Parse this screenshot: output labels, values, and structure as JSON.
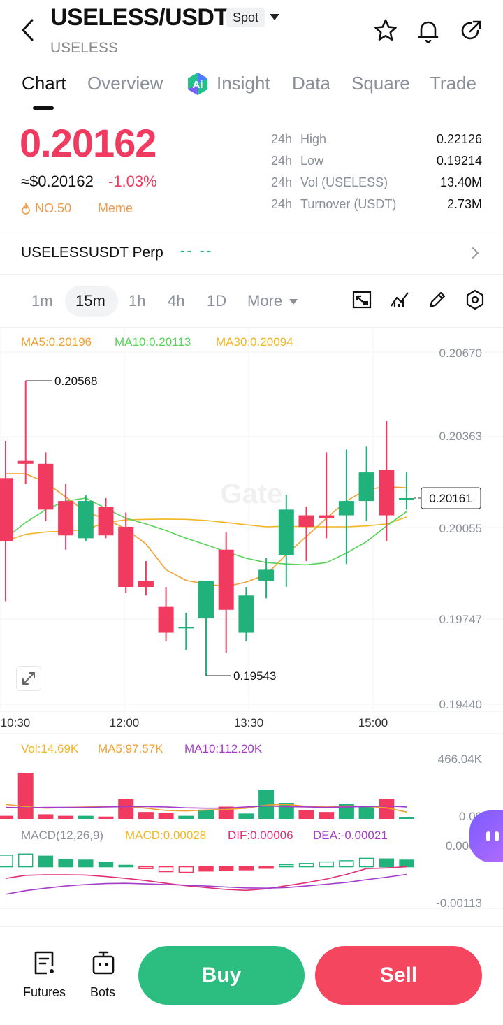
{
  "header": {
    "pair": "USELESS/USDT",
    "market_type": "Spot",
    "subtitle": "USELESS"
  },
  "tabs": [
    "Chart",
    "Overview",
    "Insight",
    "Data",
    "Square",
    "Trade"
  ],
  "price": {
    "last": "0.20162",
    "usd": "≈$0.20162",
    "change": "-1.03%",
    "rank": "NO.50",
    "tag": "Meme"
  },
  "stats": [
    {
      "period": "24h",
      "label": "High",
      "value": "0.22126"
    },
    {
      "period": "24h",
      "label": "Low",
      "value": "0.19214"
    },
    {
      "period": "24h",
      "label": "Vol (USELESS)",
      "value": "13.40M"
    },
    {
      "period": "24h",
      "label": "Turnover (USDT)",
      "value": "2.73M"
    }
  ],
  "perp": {
    "label": "USELESSUSDT Perp",
    "value": "-- --"
  },
  "intervals": [
    "1m",
    "15m",
    "1h",
    "4h",
    "1D",
    "More"
  ],
  "legend": {
    "ma5": "MA5:0.20196",
    "ma10": "MA10:0.20113",
    "ma30": "MA30:0.20094",
    "vol": "Vol:14.69K",
    "vol_ma5": "MA5:97.57K",
    "vol_ma10": "MA10:112.20K",
    "macd_title": "MACD(12,26,9)",
    "macd": "MACD:0.00028",
    "dif": "DIF:0.00006",
    "dea": "DEA:-0.00021"
  },
  "axis": {
    "price_ticks": [
      "0.20670",
      "0.20363",
      "0.20055",
      "0.19747",
      "0.19440"
    ],
    "time_ticks": [
      "10:30",
      "12:00",
      "13:30",
      "15:00"
    ],
    "vol_ticks": [
      "466.04K",
      "0.00"
    ],
    "macd_ticks": [
      "0.0007",
      "-0.00113"
    ],
    "high_marker": "0.20568",
    "low_marker": "0.19543",
    "current_label": "0.20161"
  },
  "colors": {
    "up": "#20b27a",
    "down": "#f03a5f",
    "ma5": "#f0a030",
    "ma10": "#58d35a",
    "ma30": "#f2b624",
    "vol_ma10": "#a33cc9",
    "dif": "#e0307a",
    "dea": "#a33cc9"
  },
  "chart_data": {
    "type": "candlestick",
    "ylim": [
      0.1944,
      0.2067
    ],
    "candles": [
      {
        "o": 0.2023,
        "h": 0.2036,
        "l": 0.198,
        "c": 0.2001
      },
      {
        "o": 0.2029,
        "h": 0.2057,
        "l": 0.2021,
        "c": 0.2028
      },
      {
        "o": 0.2028,
        "h": 0.2032,
        "l": 0.2008,
        "c": 0.2012
      },
      {
        "o": 0.2015,
        "h": 0.2021,
        "l": 0.1998,
        "c": 0.2003
      },
      {
        "o": 0.2002,
        "h": 0.2017,
        "l": 0.2001,
        "c": 0.2015
      },
      {
        "o": 0.2013,
        "h": 0.2016,
        "l": 0.2002,
        "c": 0.2003
      },
      {
        "o": 0.2006,
        "h": 0.2011,
        "l": 0.1983,
        "c": 0.1985
      },
      {
        "o": 0.1987,
        "h": 0.1994,
        "l": 0.1982,
        "c": 0.1985
      },
      {
        "o": 0.1978,
        "h": 0.1985,
        "l": 0.1966,
        "c": 0.1969
      },
      {
        "o": 0.1971,
        "h": 0.1976,
        "l": 0.1963,
        "c": 0.1971
      },
      {
        "o": 0.1974,
        "h": 0.1987,
        "l": 0.1954,
        "c": 0.1987
      },
      {
        "o": 0.1998,
        "h": 0.2004,
        "l": 0.1962,
        "c": 0.1977
      },
      {
        "o": 0.1969,
        "h": 0.1985,
        "l": 0.1966,
        "c": 0.1982
      },
      {
        "o": 0.1987,
        "h": 0.1995,
        "l": 0.1981,
        "c": 0.1991
      },
      {
        "o": 0.1996,
        "h": 0.2017,
        "l": 0.1985,
        "c": 0.2012
      },
      {
        "o": 0.201,
        "h": 0.2013,
        "l": 0.1994,
        "c": 0.2006
      },
      {
        "o": 0.201,
        "h": 0.2032,
        "l": 0.2002,
        "c": 0.2009
      },
      {
        "o": 0.201,
        "h": 0.2033,
        "l": 0.1993,
        "c": 0.2015
      },
      {
        "o": 0.2015,
        "h": 0.2034,
        "l": 0.2008,
        "c": 0.2025
      },
      {
        "o": 0.2026,
        "h": 0.2043,
        "l": 0.2001,
        "c": 0.201
      },
      {
        "o": 0.2016,
        "h": 0.2025,
        "l": 0.2012,
        "c": 0.2016
      }
    ],
    "ma5": [
      0.20245,
      0.20245,
      0.20215,
      0.20164,
      0.20112,
      0.20087,
      0.20053,
      0.2,
      0.1991,
      0.19873,
      0.1986,
      0.19851,
      0.19867,
      0.19893,
      0.19963,
      0.20026,
      0.2009,
      0.2015,
      0.2019,
      0.202,
      0.20196
    ],
    "ma10": [
      0.2002,
      0.20075,
      0.2012,
      0.2015,
      0.2016,
      0.20124,
      0.2009,
      0.2007,
      0.20047,
      0.2002,
      0.19997,
      0.19973,
      0.1995,
      0.19935,
      0.1993,
      0.19927,
      0.19935,
      0.19968,
      0.20008,
      0.20063,
      0.20113
    ],
    "ma30": [
      0.2001,
      0.20034,
      0.20042,
      0.20045,
      0.2005,
      0.20075,
      0.20084,
      0.20086,
      0.20087,
      0.20086,
      0.20082,
      0.20075,
      0.20067,
      0.2006,
      0.20062,
      0.2006,
      0.2006,
      0.2006,
      0.20063,
      0.2007,
      0.20094
    ],
    "volume_ylim": [
      0,
      466.04
    ],
    "volume": [
      20,
      300,
      30,
      20,
      20,
      15,
      130,
      45,
      40,
      20,
      60,
      80,
      35,
      190,
      105,
      55,
      45,
      100,
      80,
      130,
      10
    ],
    "volume_ma5": [
      95,
      80,
      70,
      75,
      78,
      80,
      82,
      70,
      55,
      52,
      58,
      62,
      70,
      90,
      95,
      82,
      78,
      85,
      82,
      72,
      45
    ],
    "volume_ma10": [
      75,
      72,
      75,
      75,
      75,
      78,
      80,
      80,
      78,
      72,
      70,
      70,
      78,
      85,
      80,
      78,
      75,
      78,
      80,
      85,
      78
    ],
    "macd_ylim": [
      -0.00113,
      0.0007
    ],
    "macd": [
      0.00038,
      0.00042,
      0.00035,
      0.00025,
      0.00022,
      0.00015,
      5e-05,
      -6e-05,
      -0.00016,
      -0.00018,
      -0.00014,
      -0.00013,
      -0.0001,
      -5e-05,
      7e-05,
      0.00011,
      0.00016,
      0.0002,
      0.00028,
      0.00026,
      0.00022
    ],
    "dif": [
      -0.00038,
      -0.00028,
      -0.00026,
      -0.00026,
      -0.00027,
      -0.00032,
      -0.00038,
      -0.00045,
      -0.00054,
      -0.00062,
      -0.00068,
      -0.00074,
      -0.00077,
      -0.00072,
      -0.00062,
      -0.00052,
      -0.0004,
      -0.00025,
      -6e-05,
      -4e-05,
      0.0
    ],
    "dea": [
      -0.0009,
      -0.00078,
      -0.0007,
      -0.00063,
      -0.00058,
      -0.00055,
      -0.00054,
      -0.00056,
      -0.00058,
      -0.0006,
      -0.00063,
      -0.00066,
      -0.00069,
      -0.0007,
      -0.00068,
      -0.00063,
      -0.00057,
      -0.00051,
      -0.00042,
      -0.00034,
      -0.00025
    ]
  },
  "bottom": {
    "futures": "Futures",
    "bots": "Bots",
    "buy": "Buy",
    "sell": "Sell"
  }
}
